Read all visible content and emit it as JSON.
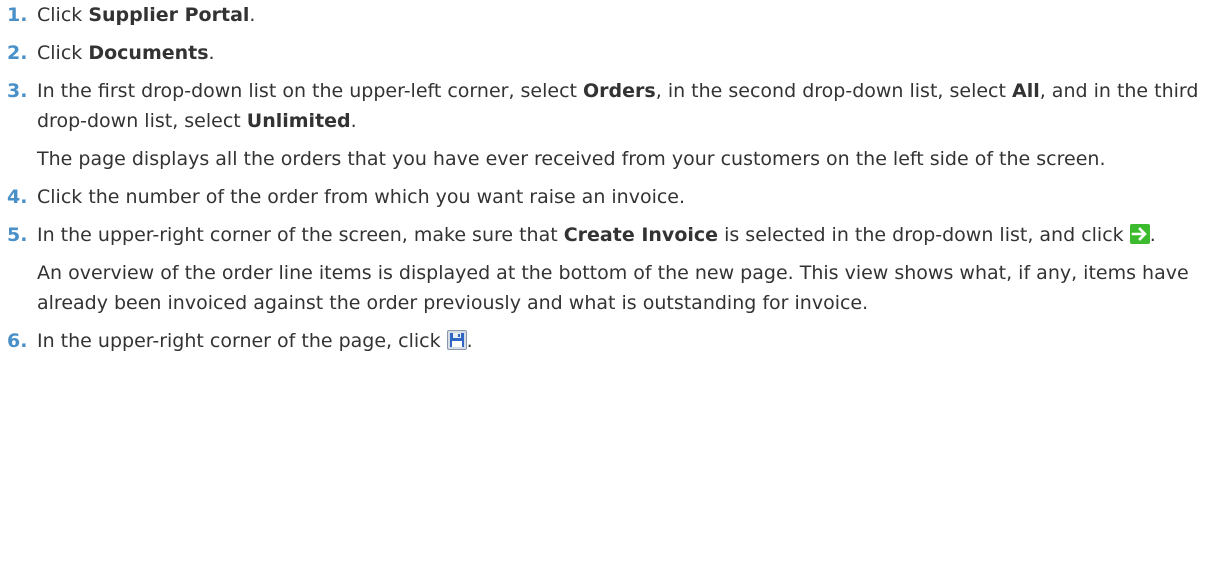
{
  "steps": [
    {
      "number": "1.",
      "text_before": "Click ",
      "bold": "Supplier Portal",
      "text_after": "."
    },
    {
      "number": "2.",
      "text_before": "Click ",
      "bold": "Documents",
      "text_after": "."
    },
    {
      "number": "3.",
      "t1": "In the first drop-down list on the upper-left corner, select ",
      "b1": "Orders",
      "t2": ", in the second drop-down list, select ",
      "b2": "All",
      "t3": ", and in the third drop-down list, select ",
      "b3": "Unlimited",
      "t4": ".",
      "note": "The page displays all the orders that you have ever received from your customers on the left side of the screen."
    },
    {
      "number": "4.",
      "text": "Click the number of the order from which you want raise an invoice."
    },
    {
      "number": "5.",
      "t1": "In the upper-right corner of the screen, make sure that ",
      "b1": "Create Invoice",
      "t2": " is selected in the drop-down list, and click ",
      "t3": ".",
      "icon": "green-arrow-right-icon",
      "note": "An overview of the order line items is displayed at the bottom of the new page. This view shows what, if any, items have already been invoiced against the order previously and what is outstanding for invoice."
    },
    {
      "number": "6.",
      "t1": "In the upper-right corner of the page, click ",
      "t2": ".",
      "icon": "save-icon"
    }
  ],
  "colors": {
    "step_number": "#4a90c8",
    "text": "#333333",
    "arrow_icon": "#3dbb2e"
  }
}
